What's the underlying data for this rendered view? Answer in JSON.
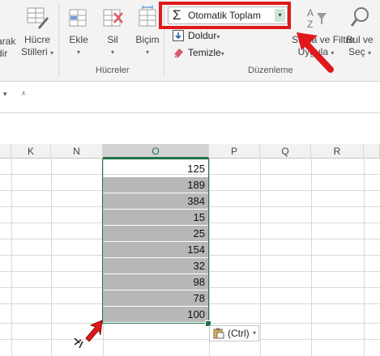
{
  "ribbon": {
    "partial_left_1": "arak",
    "partial_left_2": "dir",
    "hucre_stilleri_1": "Hücre",
    "hucre_stilleri_2": "Stilleri",
    "ekle": "Ekle",
    "sil": "Sil",
    "bicim": "Biçim",
    "hucreler_group": "Hücreler",
    "autosum": "Otomatik Toplam",
    "doldur": "Doldur",
    "temizle": "Temizle",
    "duzenleme_group": "Düzenleme",
    "sirala_1": "Sırala ve Filtre",
    "sirala_2": "Uygula",
    "bul_1": "Bul ve",
    "bul_2": "Seç"
  },
  "columns": [
    "K",
    "N",
    "O",
    "P",
    "Q",
    "R"
  ],
  "selected_column": "O",
  "cells": [
    "125",
    "189",
    "384",
    "15",
    "25",
    "154",
    "32",
    "98",
    "78",
    "100"
  ],
  "paste_options": "(Ctrl)",
  "colors": {
    "accent": "#217346",
    "highlight": "#e0181b",
    "selection": "#b7b7b7"
  }
}
